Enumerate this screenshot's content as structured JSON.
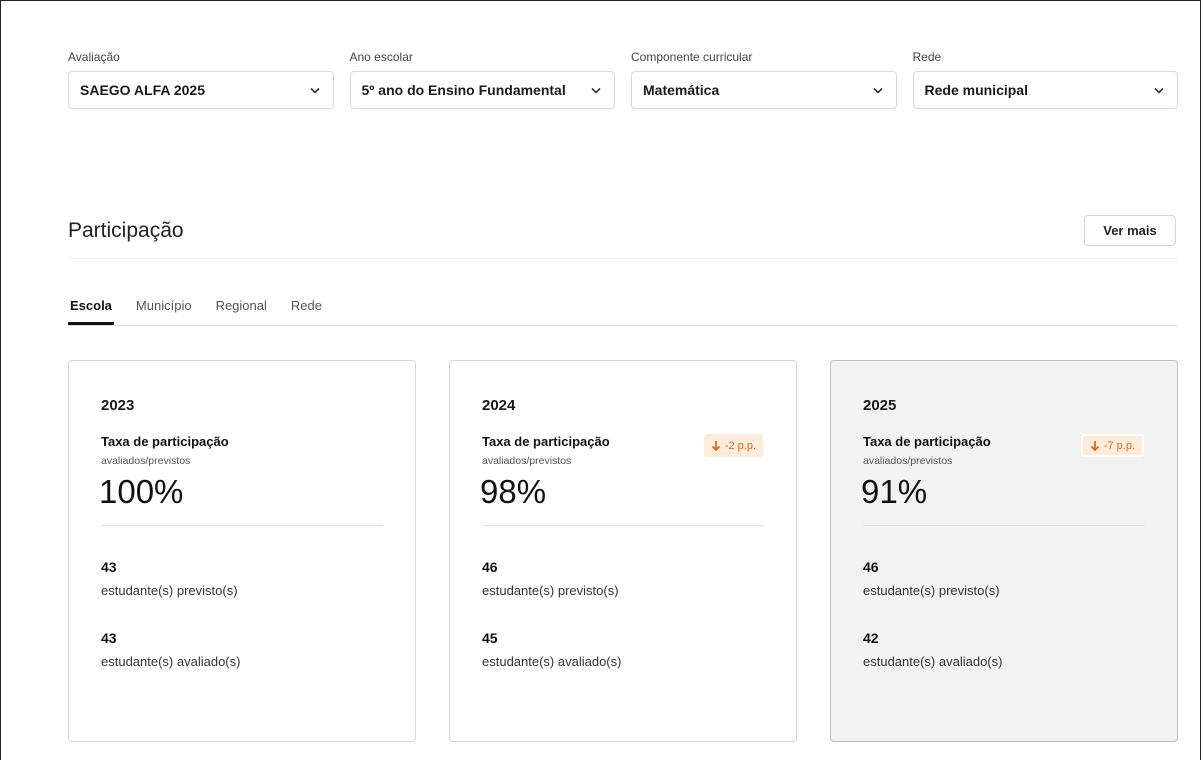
{
  "filters": [
    {
      "label": "Avaliação",
      "value": "SAEGO ALFA 2025"
    },
    {
      "label": "Ano escolar",
      "value": "5º ano do Ensino Fundamental"
    },
    {
      "label": "Componente curricular",
      "value": "Matemática"
    },
    {
      "label": "Rede",
      "value": "Rede municipal"
    }
  ],
  "section": {
    "title": "Participação",
    "more_label": "Ver mais"
  },
  "tabs": [
    {
      "label": "Escola",
      "active": true
    },
    {
      "label": "Município",
      "active": false
    },
    {
      "label": "Regional",
      "active": false
    },
    {
      "label": "Rede",
      "active": false
    }
  ],
  "cards": [
    {
      "year": "2023",
      "rate_label": "Taxa de participação",
      "rate_sub": "avaliados/previstos",
      "rate": "100%",
      "badge": "",
      "expected_count": "43",
      "expected_label": "estudante(s) previsto(s)",
      "evaluated_count": "43",
      "evaluated_label": "estudante(s) avaliado(s)"
    },
    {
      "year": "2024",
      "rate_label": "Taxa de participação",
      "rate_sub": "avaliados/previstos",
      "rate": "98%",
      "badge": "-2 p.p.",
      "expected_count": "46",
      "expected_label": "estudante(s) previsto(s)",
      "evaluated_count": "45",
      "evaluated_label": "estudante(s) avaliado(s)"
    },
    {
      "year": "2025",
      "rate_label": "Taxa de participação",
      "rate_sub": "avaliados/previstos",
      "rate": "91%",
      "badge": "-7 p.p.",
      "expected_count": "46",
      "expected_label": "estudante(s) previsto(s)",
      "evaluated_count": "42",
      "evaluated_label": "estudante(s) avaliado(s)"
    }
  ],
  "colors": {
    "badge_text": "#d86a1c",
    "badge_bg": "#fdecdc",
    "highlight_card": "#f2f2f2"
  },
  "icons": {
    "select": "chevron-down-icon",
    "badge": "arrow-down-icon"
  }
}
